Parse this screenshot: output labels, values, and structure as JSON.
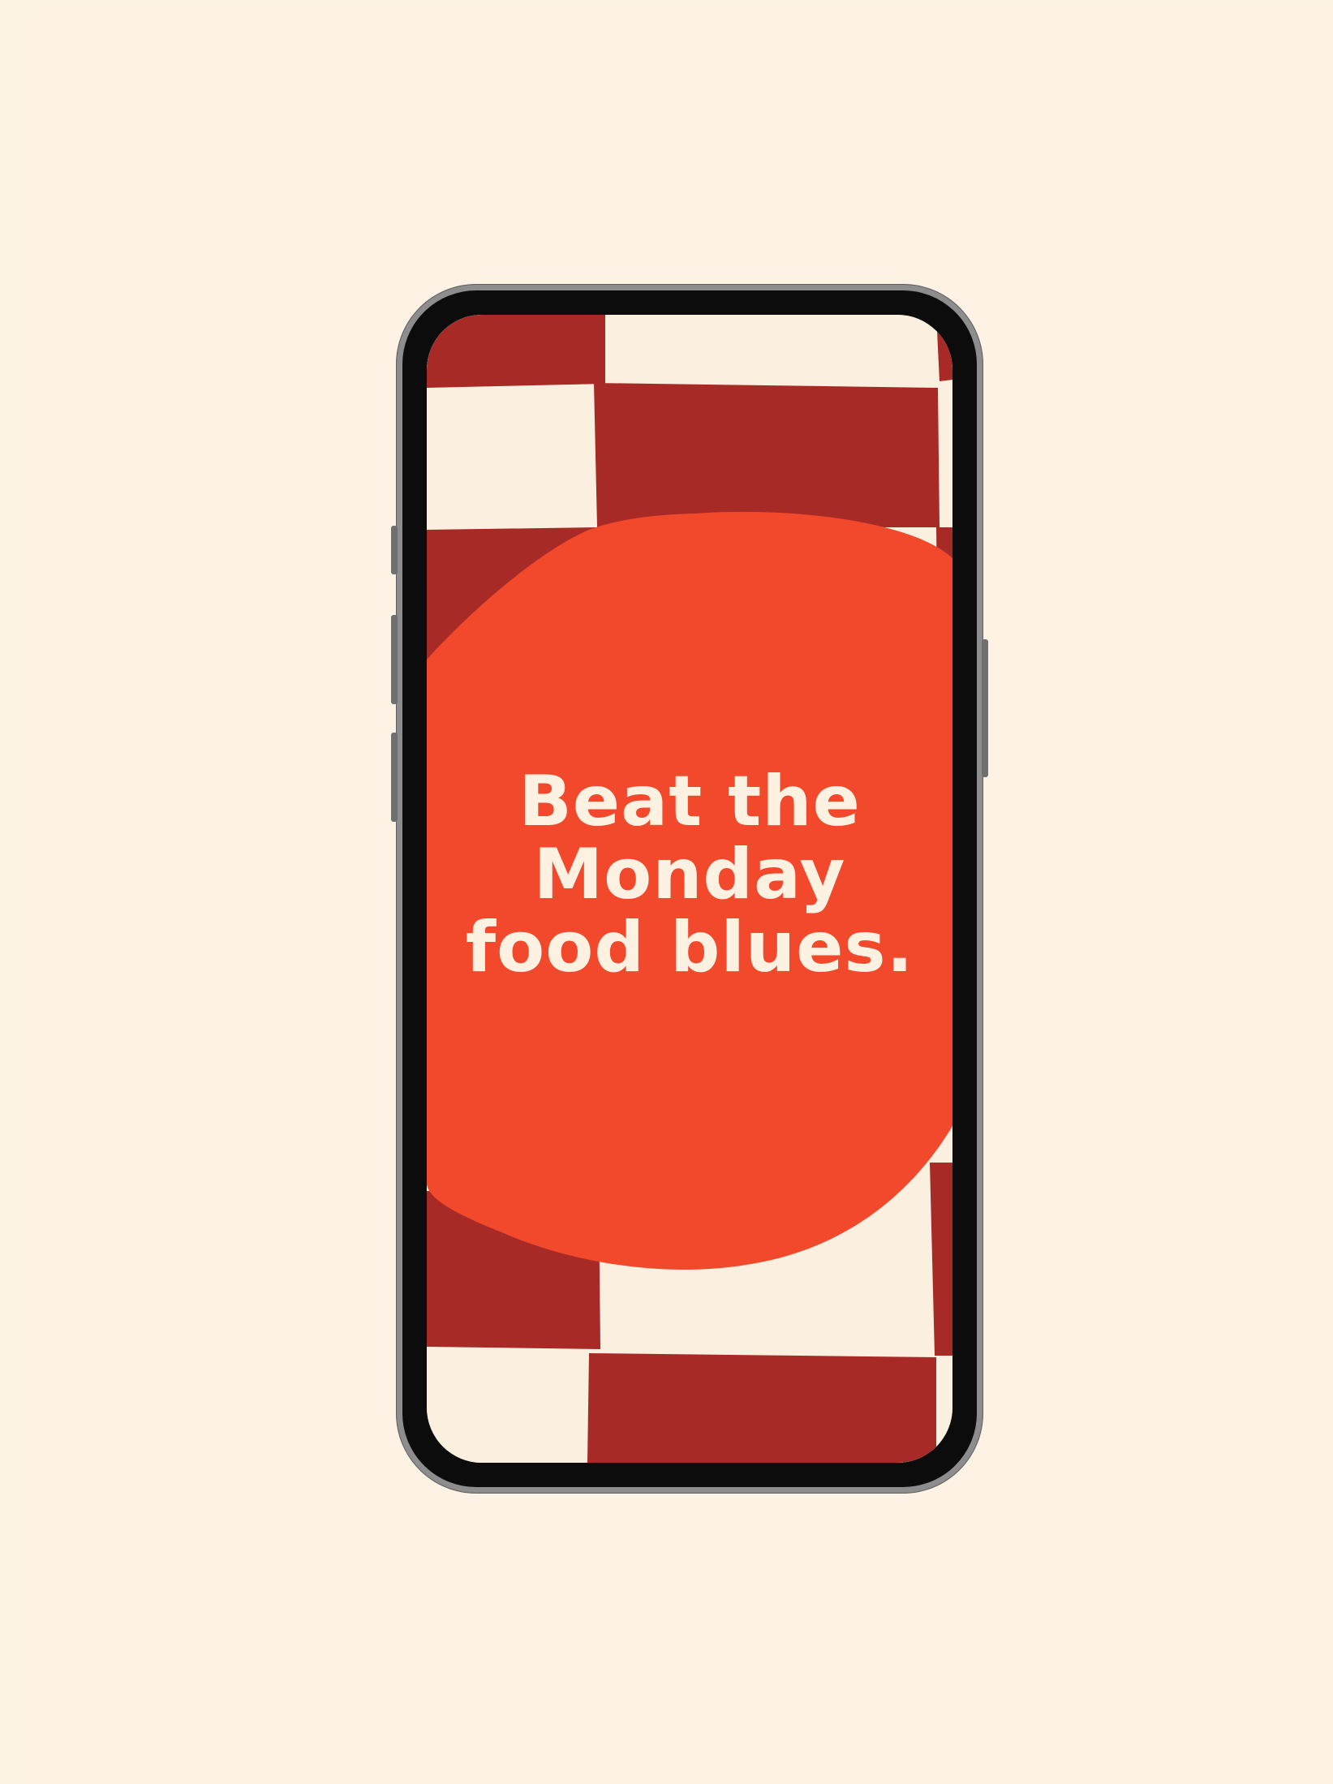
{
  "colors": {
    "page_background": "#FDF3E5",
    "checker_dark": "#A72A27",
    "checker_light": "#FBF0DF",
    "blob": "#F2482B",
    "headline_text": "#FDF1E2",
    "phone_frame": "#0c0c0c"
  },
  "headline": {
    "line1": "Beat the",
    "line2": "Monday",
    "line3": "food blues."
  }
}
